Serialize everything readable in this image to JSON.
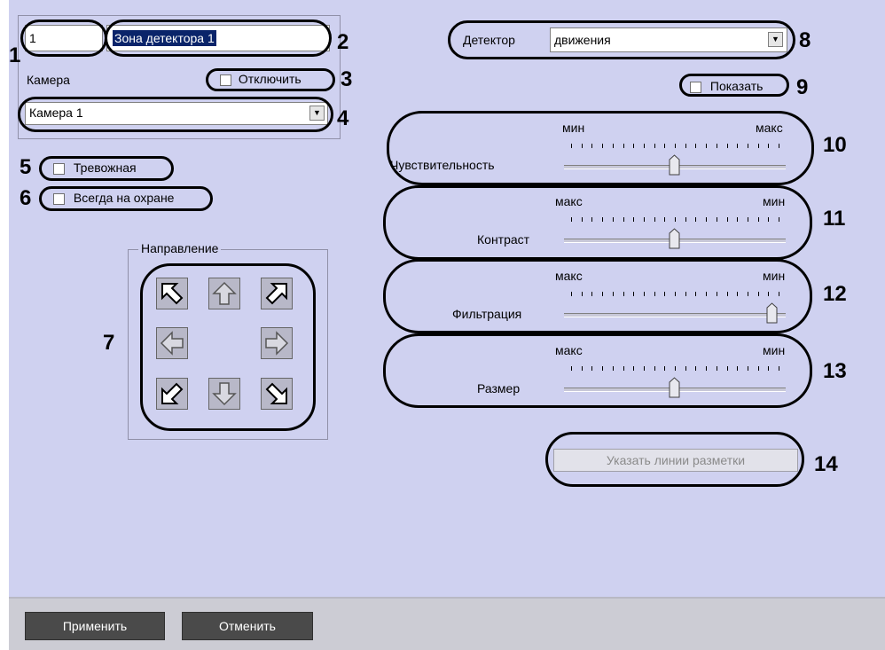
{
  "zone": {
    "number_value": "1",
    "name_value": "Зона детектора 1",
    "camera_label": "Камера",
    "disable_label": "Отключить",
    "camera_value": "Камера 1"
  },
  "checks": {
    "alarm_label": "Тревожная",
    "always_armed_label": "Всегда на охране"
  },
  "direction": {
    "group_label": "Направление"
  },
  "detector": {
    "label": "Детектор",
    "value": "движения",
    "show_label": "Показать"
  },
  "sliders": [
    {
      "label": "Чувствительность",
      "left": "мин",
      "right": "макс",
      "position": 0.5
    },
    {
      "label": "Контраст",
      "left": "макс",
      "right": "мин",
      "position": 0.5
    },
    {
      "label": "Фильтрация",
      "left": "макс",
      "right": "мин",
      "position": 1.0
    },
    {
      "label": "Размер",
      "left": "макс",
      "right": "мин",
      "position": 0.5
    }
  ],
  "markup_button": "Указать линии разметки",
  "footer": {
    "apply": "Применить",
    "cancel": "Отменить"
  },
  "callouts": [
    "1",
    "2",
    "3",
    "4",
    "5",
    "6",
    "7",
    "8",
    "9",
    "10",
    "11",
    "12",
    "13",
    "14"
  ],
  "colors": {
    "panel": "#cfd1f0",
    "highlight": "#0a246a",
    "footer_button": "#4a4a4a"
  }
}
